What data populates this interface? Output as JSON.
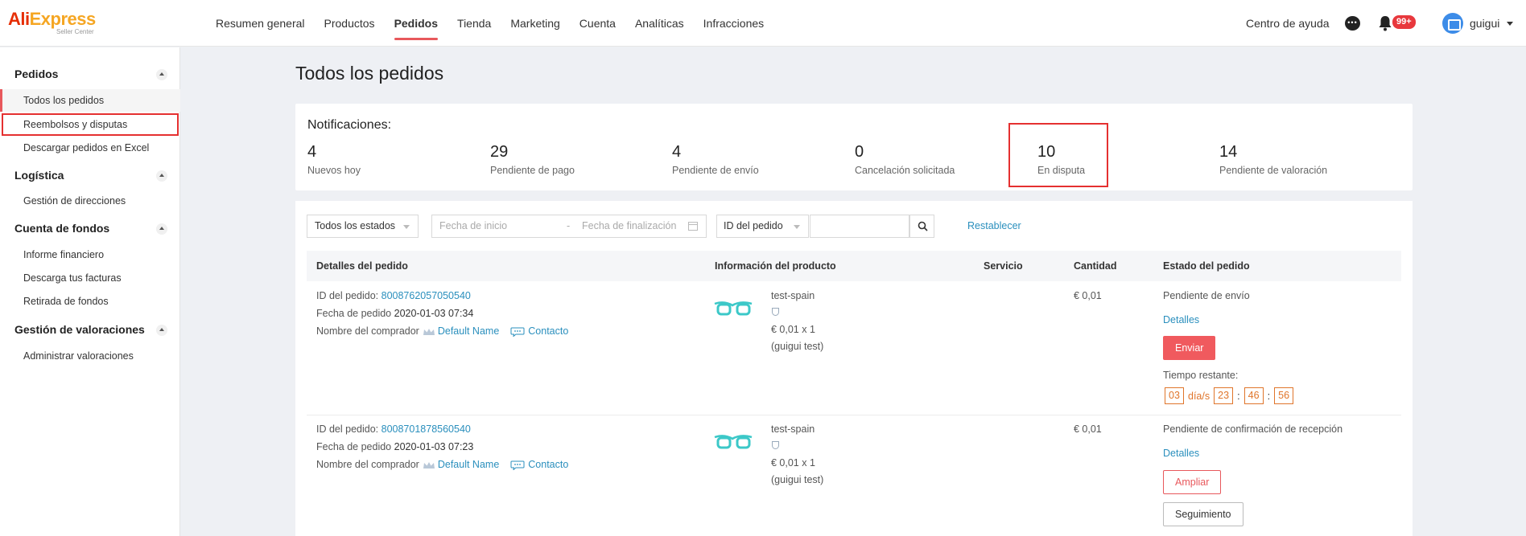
{
  "brand": {
    "name_a": "Ali",
    "name_b": "Express",
    "sub": "Seller Center"
  },
  "nav": {
    "items": [
      "Resumen general",
      "Productos",
      "Pedidos",
      "Tienda",
      "Marketing",
      "Cuenta",
      "Analíticas",
      "Infracciones"
    ],
    "active": "Pedidos"
  },
  "topbar": {
    "help": "Centro de ayuda",
    "badge": "99+",
    "user": "guigui"
  },
  "sidebar": {
    "groups": [
      {
        "title": "Pedidos",
        "items": [
          "Todos los pedidos",
          "Reembolsos y disputas",
          "Descargar pedidos en Excel"
        ]
      },
      {
        "title": "Logística",
        "items": [
          "Gestión de direcciones"
        ]
      },
      {
        "title": "Cuenta de fondos",
        "items": [
          "Informe financiero",
          "Descarga tus facturas",
          "Retirada de fondos"
        ]
      },
      {
        "title": "Gestión de valoraciones",
        "items": [
          "Administrar valoraciones"
        ]
      }
    ]
  },
  "page": {
    "title": "Todos los pedidos"
  },
  "notifications": {
    "label": "Notificaciones:",
    "stats": [
      {
        "value": "4",
        "label": "Nuevos hoy"
      },
      {
        "value": "29",
        "label": "Pendiente de pago"
      },
      {
        "value": "4",
        "label": "Pendiente de envío"
      },
      {
        "value": "0",
        "label": "Cancelación solicitada"
      },
      {
        "value": "10",
        "label": "En disputa"
      },
      {
        "value": "14",
        "label": "Pendiente de valoración"
      }
    ]
  },
  "filters": {
    "status": "Todos los estados",
    "date_start": "Fecha de inicio",
    "date_sep": "-",
    "date_end": "Fecha de finalización",
    "search_type": "ID del pedido",
    "search_value": "",
    "reset": "Restablecer"
  },
  "table": {
    "headers": [
      "Detalles del pedido",
      "Información del producto",
      "Servicio",
      "Cantidad",
      "Estado del pedido"
    ],
    "labels": {
      "order_id": "ID del pedido:",
      "order_date": "Fecha de pedido",
      "buyer": "Nombre del comprador",
      "contact": "Contacto"
    },
    "rows": [
      {
        "order_id": "8008762057050540",
        "date": "2020-01-03 07:34",
        "buyer": "Default Name",
        "product": "test-spain",
        "price_qty": "€ 0,01 x 1",
        "variant": "(guigui test)",
        "amount": "€ 0,01",
        "status": "Pendiente de envío",
        "details": "Detalles",
        "primary_action": "Enviar",
        "time_label": "Tiempo restante:",
        "countdown": {
          "days": "03",
          "days_label": "día/s",
          "h": "23",
          "m": "46",
          "s": "56"
        }
      },
      {
        "order_id": "8008701878560540",
        "date": "2020-01-03 07:23",
        "buyer": "Default Name",
        "product": "test-spain",
        "price_qty": "€ 0,01 x 1",
        "variant": "(guigui test)",
        "amount": "€ 0,01",
        "status": "Pendiente de confirmación de recepción",
        "details": "Detalles",
        "action_extend": "Ampliar",
        "action_track": "Seguimiento"
      }
    ]
  },
  "colors": {
    "accent": "#e8585c",
    "link": "#2a8fbd",
    "timer": "#e0752b",
    "highlight": "#e53030"
  }
}
